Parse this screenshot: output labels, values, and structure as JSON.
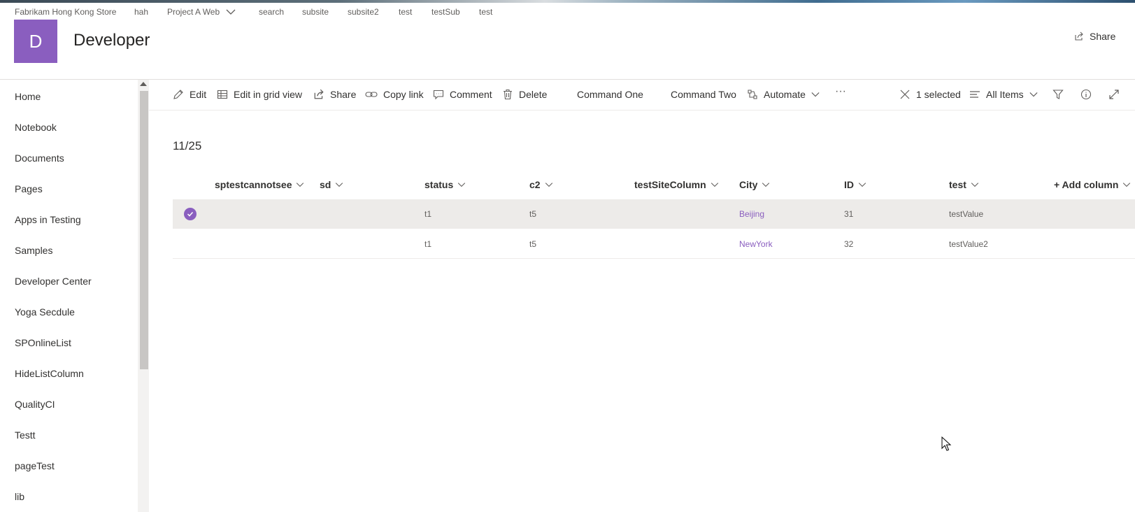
{
  "topnav": {
    "items": [
      "Fabrikam Hong Kong Store",
      "hah",
      "Project A Web",
      "search",
      "subsite",
      "subsite2",
      "test",
      "testSub",
      "test"
    ]
  },
  "site": {
    "logo_letter": "D",
    "title": "Developer",
    "share_label": "Share",
    "brand_color": "#8a5ebf"
  },
  "leftnav": {
    "items": [
      "Home",
      "Notebook",
      "Documents",
      "Pages",
      "Apps in Testing",
      "Samples",
      "Developer Center",
      "Yoga Secdule",
      "SPOnlineList",
      "HideListColumn",
      "QualityCI",
      "Testt",
      "pageTest",
      "lib"
    ]
  },
  "commandbar": {
    "edit": "Edit",
    "edit_grid": "Edit in grid view",
    "share": "Share",
    "copy_link": "Copy link",
    "comment": "Comment",
    "delete": "Delete",
    "command_one": "Command One",
    "command_two": "Command Two",
    "automate": "Automate",
    "more": "···",
    "selected": "1 selected",
    "view": "All Items"
  },
  "list": {
    "count": "11/25",
    "columns": [
      "sptestcannotsee",
      "sd",
      "status",
      "c2",
      "testSiteColumn",
      "City",
      "ID",
      "test"
    ],
    "add_column": "+ Add column",
    "rows": [
      {
        "selected": true,
        "sptestcannotsee": "",
        "sd": "",
        "status": "t1",
        "c2": "t5",
        "testSiteColumn": "",
        "city": "Beijing",
        "id": "31",
        "test": "testValue"
      },
      {
        "selected": false,
        "sptestcannotsee": "",
        "sd": "",
        "status": "t1",
        "c2": "t5",
        "testSiteColumn": "",
        "city": "NewYork",
        "id": "32",
        "test": "testValue2"
      }
    ]
  }
}
